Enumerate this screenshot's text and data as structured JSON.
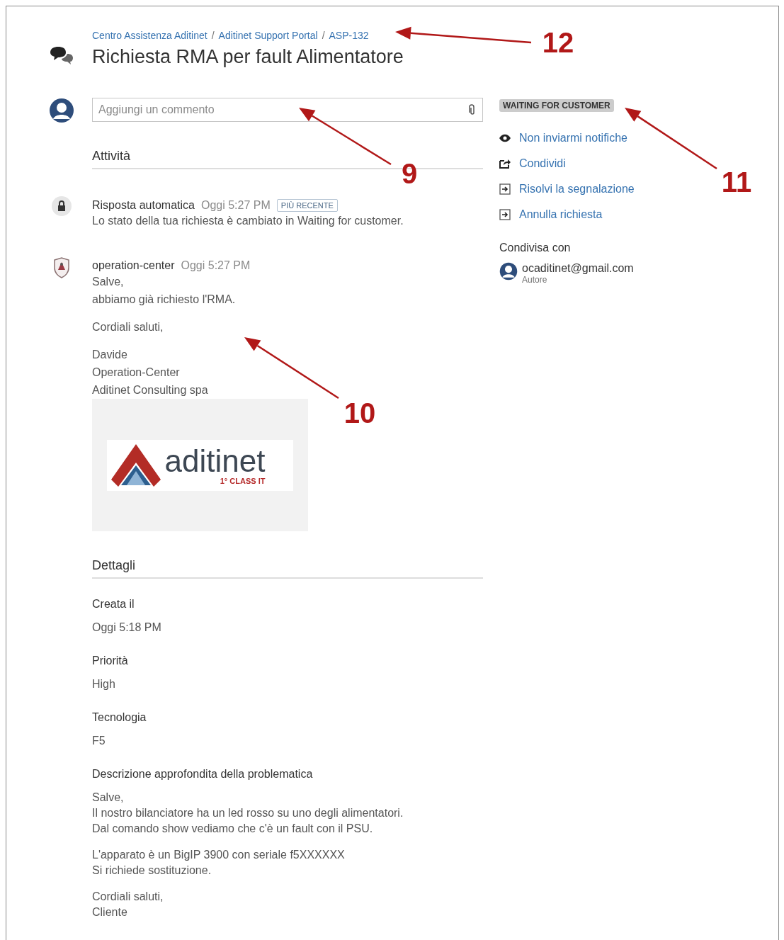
{
  "header": {
    "breadcrumbs": [
      "Centro Assistenza Aditinet",
      "Aditinet Support Portal",
      "ASP-132"
    ],
    "breadcrumb_separator": "/",
    "title": "Richiesta RMA per fault Alimentatore"
  },
  "comment_field": {
    "placeholder": "Aggiungi un commento"
  },
  "activity": {
    "heading": "Attività",
    "items": [
      {
        "kind": "automatic",
        "author": "Risposta automatica",
        "time": "Oggi 5:27 PM",
        "badge": "PIÙ RECENTE",
        "paragraphs": [
          [
            "Lo stato della tua richiesta è cambiato in Waiting for customer."
          ]
        ]
      },
      {
        "kind": "agent",
        "author": "operation-center",
        "time": "Oggi 5:27 PM",
        "paragraphs": [
          [
            "Salve,",
            "abbiamo già richiesto l'RMA."
          ],
          [
            "Cordiali saluti,"
          ],
          [
            "Davide",
            "Operation-Center",
            "Aditinet Consulting spa"
          ]
        ],
        "signature_logo": {
          "wordmark": "aditinet",
          "tagline": "1° CLASS IT"
        }
      }
    ]
  },
  "details": {
    "heading": "Dettagli",
    "fields": [
      {
        "label": "Creata il",
        "paragraphs": [
          [
            "Oggi 5:18 PM"
          ]
        ]
      },
      {
        "label": "Priorità",
        "paragraphs": [
          [
            "High"
          ]
        ]
      },
      {
        "label": "Tecnologia",
        "paragraphs": [
          [
            "F5"
          ]
        ]
      },
      {
        "label": "Descrizione approfondita della problematica",
        "paragraphs": [
          [
            "Salve,",
            "Il nostro bilanciatore ha un led rosso su uno degli alimentatori.",
            "Dal comando show vediamo che c'è un fault con il PSU."
          ],
          [
            "L'apparato è un BigIP 3900 con seriale f5XXXXXX",
            "Si richiede sostituzione."
          ],
          [
            "Cordiali saluti,",
            "Cliente"
          ]
        ]
      }
    ]
  },
  "sidebar": {
    "status": "WAITING FOR CUSTOMER",
    "actions": [
      {
        "kind": "watch",
        "label": "Non inviarmi notifiche"
      },
      {
        "kind": "share",
        "label": "Condividi"
      },
      {
        "kind": "transition",
        "label": "Risolvi la segnalazione"
      },
      {
        "kind": "transition",
        "label": "Annulla richiesta"
      }
    ],
    "shared_with": {
      "heading": "Condivisa con",
      "people": [
        {
          "email": "ocaditinet@gmail.com",
          "role": "Autore"
        }
      ]
    }
  },
  "callouts": [
    {
      "number": "12"
    },
    {
      "number": "9"
    },
    {
      "number": "11"
    },
    {
      "number": "10"
    }
  ]
}
